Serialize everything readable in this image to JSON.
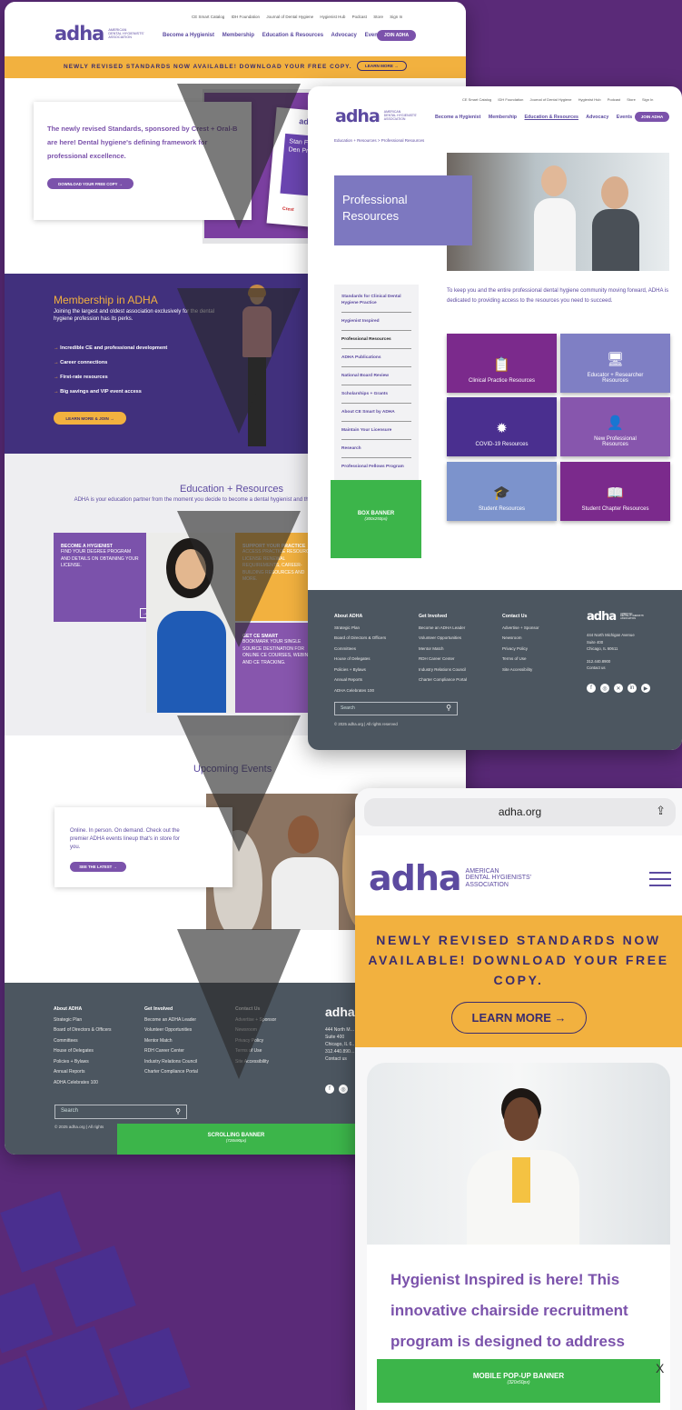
{
  "logo": {
    "mark": "adha",
    "line1": "American",
    "line2": "Dental Hygienists'",
    "line3": "Association"
  },
  "desktop": {
    "utility_links": [
      "CE Smart Catalog",
      "IDH Foundation",
      "Journal of Dental Hygiene",
      "Hygienist Hub",
      "Podcast",
      "Store",
      "Sign In"
    ],
    "nav": [
      "Become a Hygienist",
      "Membership",
      "Education & Resources",
      "Advocacy",
      "Events"
    ],
    "join": "JOIN ADHA",
    "banner_text": "NEWLY REVISED STANDARDS NOW AVAILABLE! DOWNLOAD YOUR FREE COPY.",
    "banner_btn": "LEARN MORE →",
    "hero_text": "The newly revised Standards, sponsored by Crest + Oral-B are here! Dental hygiene's defining framework for professional excellence.",
    "hero_btn": "DOWNLOAD YOUR FREE COPY →",
    "hero_book_brand": "adha",
    "hero_book_title": "Stan For Den Prac",
    "hero_book_sponsor": "Crest",
    "membership": {
      "title": "Membership in ADHA",
      "sub": "Joining the largest and oldest association exclusively for the dental hygiene profession has its perks.",
      "items": [
        "Incredible CE and professional development",
        "Career connections",
        "First-rate resources",
        "Big savings and VIP event access"
      ],
      "btn": "LEARN MORE & JOIN →"
    },
    "education": {
      "title": "Education + Resources",
      "sub": "ADHA is your education partner from the moment you decide to become a dental hygienist and throughout your oral health career.",
      "become_title": "BECOME A HYGIENIST",
      "become_text": "FIND YOUR DEGREE PROGRAM AND DETAILS ON OBTAINING YOUR LICENSE.",
      "arrow": "→",
      "support_title": "SUPPORT YOUR PRACTICE",
      "support_text": "ACCESS PRACTICE RESOURCES, LICENSE RENEWAL REQUIREMENTS, CAREER-BUILDING RESOURCES AND MORE.",
      "ce_title": "GET CE SMART",
      "ce_text": "BOOKMARK YOUR SINGLE SOURCE DESTINATION FOR ONLINE CE COURSES, WEBINARS AND CE TRACKING."
    },
    "events": {
      "title": "Upcoming Events",
      "text": "Online. In person. On demand. Check out the premier ADHA events lineup that's in store for you.",
      "btn": "SEE THE LATEST →"
    },
    "footer": {
      "cols": [
        {
          "title": "About ADHA",
          "links": [
            "Strategic Plan",
            "Board of Directors & Officers",
            "Committees",
            "House of Delegates",
            "Policies + Bylaws",
            "Annual Reports",
            "ADHA Celebrates 100"
          ]
        },
        {
          "title": "Get Involved",
          "links": [
            "Become an ADHA Leader",
            "Volunteer Opportunities",
            "Mentor Match",
            "RDH Career Center",
            "Industry Relations Council",
            "Charter Compliance Portal"
          ]
        },
        {
          "title": "Contact Us",
          "links": [
            "Advertise + Sponsor",
            "Newsroom",
            "Privacy Policy",
            "Terms of Use",
            "Site Accessibility"
          ]
        }
      ],
      "address": "444 North M… Suite 400 Chicago, IL 6…",
      "phone": "312.440.890…",
      "contact": "Contact us",
      "search": "Search",
      "copyright": "© 2025 adha.org | All rights"
    },
    "scroll_banner": {
      "title": "SCROLLING BANNER",
      "size": "(728x90px)"
    }
  },
  "resources": {
    "utility_links": [
      "CE Smart Catalog",
      "IDH Foundation",
      "Journal of Dental Hygiene",
      "Hygienist Hub",
      "Podcast",
      "Store",
      "Sign In"
    ],
    "nav": [
      "Become a Hygienist",
      "Membership",
      "Education & Resources",
      "Advocacy",
      "Events"
    ],
    "join": "JOIN ADHA",
    "breadcrumb": "Education + Resources > Professional Resources",
    "title": "Professional Resources",
    "sidebar": [
      "Standards for Clinical Dental Hygiene Practice",
      "Hygienist Inspired",
      "Professional Resources",
      "ADHA Publications",
      "National Board Review",
      "Scholarships + Grants",
      "About CE Smart by ADHA",
      "Maintain Your Licensure",
      "Research",
      "Professional Fellows Program"
    ],
    "intro": "To keep you and the entire professional dental hygiene community moving forward, ADHA is dedicated to providing access to the resources you need to succeed.",
    "tiles": [
      {
        "label": "Clinical Practice Resources",
        "icon": "📋",
        "color": "#7b2a8c"
      },
      {
        "label": "Educator + Researcher Resources",
        "icon": "🖥",
        "color": "#7f7fc4"
      },
      {
        "label": "COVID-19 Resources",
        "icon": "✹",
        "color": "#4a2f8f"
      },
      {
        "label": "New Professional Resources",
        "icon": "👤",
        "color": "#8756ad"
      },
      {
        "label": "Student Resources",
        "icon": "🎓",
        "color": "#7c93cc"
      },
      {
        "label": "Student Chapter Resources",
        "icon": "📖",
        "color": "#7b2a8c"
      }
    ],
    "box_banner": {
      "title": "BOX BANNER",
      "size": "(300x250px)"
    },
    "footer": {
      "cols": [
        {
          "title": "About ADHA",
          "links": [
            "Strategic Plan",
            "Board of Directors & Officers",
            "Committees",
            "House of Delegates",
            "Policies + Bylaws",
            "Annual Reports",
            "ADHA Celebrates 100"
          ]
        },
        {
          "title": "Get Involved",
          "links": [
            "Become an ADHA Leader",
            "Volunteer Opportunities",
            "Mentor Match",
            "RDH Career Center",
            "Industry Relations Council",
            "Charter Compliance Portal"
          ]
        },
        {
          "title": "Contact Us",
          "links": [
            "Advertise + Sponsor",
            "Newsroom",
            "Privacy Policy",
            "Terms of Use",
            "Site Accessibility"
          ]
        }
      ],
      "address1": "444 North Michigan Avenue",
      "address2": "Suite 400",
      "address3": "Chicago, IL 60611",
      "phone": "312.440.8900",
      "contact": "Contact us",
      "search": "Search",
      "copyright": "© 2025 adha.org | All rights reserved"
    }
  },
  "mobile": {
    "url": "adha.org",
    "banner_text": "NEWLY REVISED STANDARDS NOW AVAILABLE! DOWNLOAD YOUR FREE COPY.",
    "banner_btn": "LEARN MORE →",
    "hero_text": "Hygienist Inspired is here! This innovative chairside recruitment program is designed to address diversity and improve access to",
    "popup": {
      "title": "MOBILE POP-UP BANNER",
      "size": "(320x50px)",
      "close": "X"
    }
  },
  "colors": {
    "purple": "#5c4aa0",
    "banner_orange": "#f2b13f",
    "green": "#3cb54a",
    "footer": "#4c5660"
  }
}
